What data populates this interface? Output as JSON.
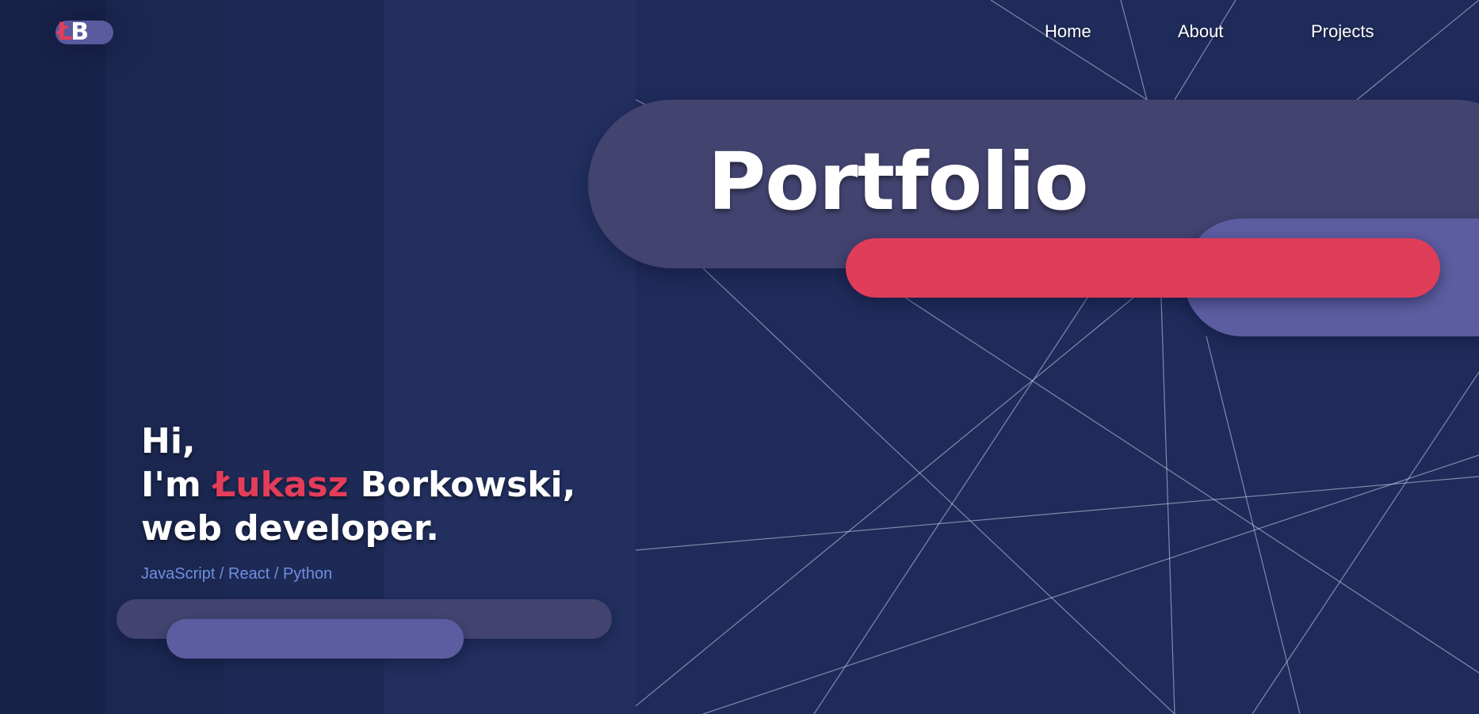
{
  "logo": {
    "letter1": "Ł",
    "letter2": "B"
  },
  "nav": {
    "items": [
      {
        "label": "Home"
      },
      {
        "label": "About"
      },
      {
        "label": "Projects"
      }
    ]
  },
  "hero": {
    "title": "Portfolio"
  },
  "intro": {
    "greeting": "Hi,",
    "prefix": "I'm ",
    "first_name": "Łukasz",
    "last_name": " Borkowski,",
    "role": "web developer.",
    "skills": "JavaScript / React / Python"
  },
  "colors": {
    "background": "#1f2b57",
    "accent_red": "#e33d5a",
    "pill_dark": "#434370",
    "pill_purple": "#5c5ca0",
    "skills_text": "#6f8fe0"
  }
}
